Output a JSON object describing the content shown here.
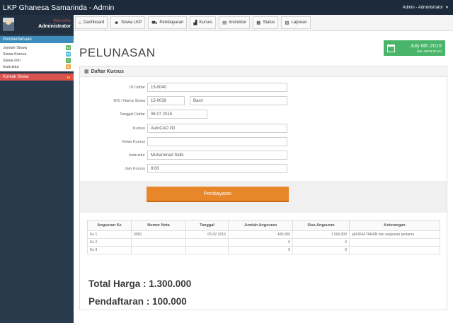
{
  "app": {
    "title": "LKP Ghanesa Samarinda - Admin",
    "user_menu": "Admin - Administrator"
  },
  "sidebar": {
    "welcome": "Welcome",
    "role": "Administrator",
    "notifications_header": "Pemberitahuan",
    "items": [
      {
        "label": "Jumlah Siswa",
        "count": "40",
        "color": "#5cb85c"
      },
      {
        "label": "Siswa Kursus",
        "count": "24",
        "color": "#5bc0de"
      },
      {
        "label": "Siswa Izin",
        "count": "0",
        "color": "#5cb85c"
      },
      {
        "label": "Instruktur",
        "count": "5",
        "color": "#f0ad4e"
      }
    ],
    "kontak": {
      "label": "Kontak Siswa",
      "count": "39"
    }
  },
  "nav": {
    "items": [
      {
        "label": "Dashboard",
        "icon": "home-icon"
      },
      {
        "label": "Siswa LKP",
        "icon": "users-icon"
      },
      {
        "label": "Pembayaran",
        "icon": "cart-icon"
      },
      {
        "label": "Kursus",
        "icon": "chart-icon"
      },
      {
        "label": "Instruktur",
        "icon": "list-icon"
      },
      {
        "label": "Status",
        "icon": "table-icon"
      },
      {
        "label": "Laporan",
        "icon": "report-icon"
      }
    ]
  },
  "page": {
    "title": "PELUNASAN",
    "date_main": "July 6th 2015",
    "date_sub": "Mon 08:04:02 pm",
    "panel_title": "Daftar Kursus"
  },
  "form": {
    "id_daftar": {
      "label": "ID Daftar",
      "value": "15-0040"
    },
    "nis_nama": {
      "label": "NIS / Nama Siswa",
      "nis": "15-0039",
      "nama": "Basri"
    },
    "tanggal": {
      "label": "Tanggal Daftar",
      "value": "06 07 2015"
    },
    "kursus": {
      "label": "Kursus",
      "value": "AutoCAD 2D"
    },
    "kelas": {
      "label": "Kelas Kursus",
      "value": ""
    },
    "instruktur": {
      "label": "Instruktur",
      "value": "Muhammad Sidik"
    },
    "jam": {
      "label": "Jam Kursus",
      "value": "8:00"
    },
    "pay_button": "Pembayaran"
  },
  "table": {
    "headers": [
      "Angsuran Ke",
      "Nomor Nota",
      "Tanggal",
      "Jumlah Angsuran",
      "Sisa Angsuran",
      "Keterangan"
    ],
    "rows": [
      [
        "Ke 1",
        "0090",
        "05-07-2015",
        "400.000",
        "1.000.000",
        "pENDAFTARAN dan angsuran pertama"
      ],
      [
        "Ke 2",
        "",
        "",
        "0",
        "0",
        ""
      ],
      [
        "Ke 3",
        "",
        "",
        "0",
        "0",
        ""
      ]
    ]
  },
  "totals": {
    "total_harga": "Total Harga : 1.300.000",
    "pendaftaran": "Pendaftaran : 100.000"
  }
}
